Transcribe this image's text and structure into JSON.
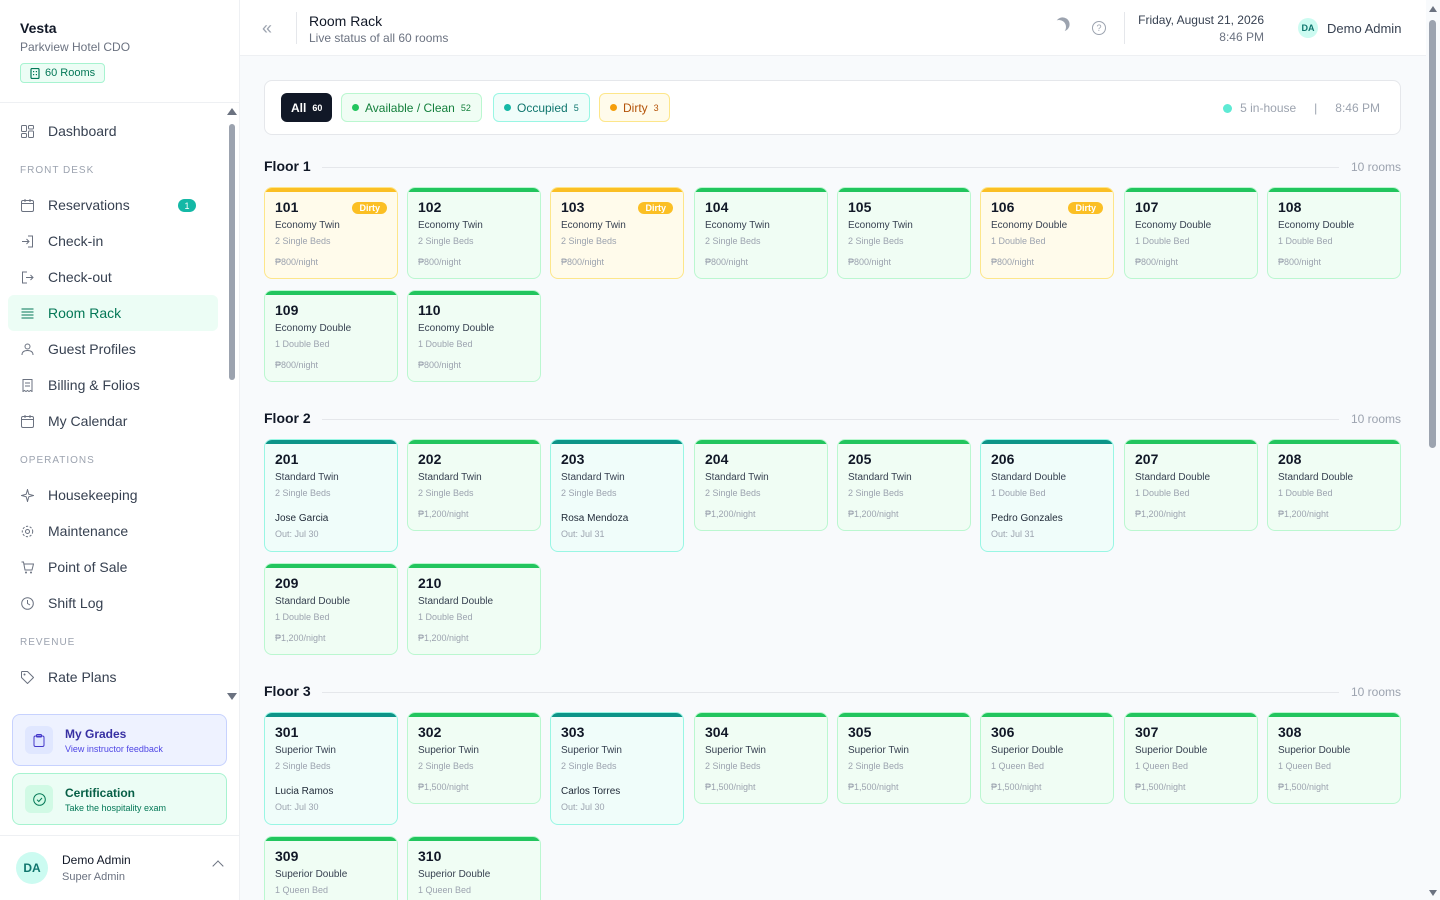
{
  "brand": {
    "name": "Vesta",
    "property": "Parkview Hotel CDO",
    "rooms_chip": "60 Rooms"
  },
  "nav": {
    "dashboard": "Dashboard",
    "front_desk_label": "FRONT DESK",
    "reservations": "Reservations",
    "reservations_badge": "1",
    "checkin": "Check-in",
    "checkout": "Check-out",
    "room_rack": "Room Rack",
    "guest_profiles": "Guest Profiles",
    "billing": "Billing & Folios",
    "calendar": "My Calendar",
    "operations_label": "OPERATIONS",
    "housekeeping": "Housekeeping",
    "maintenance": "Maintenance",
    "pos": "Point of Sale",
    "shift_log": "Shift Log",
    "revenue_label": "REVENUE",
    "rate_plans": "Rate Plans"
  },
  "promos": {
    "grades_title": "My Grades",
    "grades_sub": "View instructor feedback",
    "cert_title": "Certification",
    "cert_sub": "Take the hospitality exam"
  },
  "user": {
    "initials": "DA",
    "name": "Demo Admin",
    "role": "Super Admin"
  },
  "header": {
    "title": "Room Rack",
    "subtitle": "Live status of all 60 rooms",
    "date": "Friday, August 21, 2026",
    "time": "8:46 PM",
    "user_initials": "DA",
    "user_name": "Demo Admin"
  },
  "filters": {
    "all_label": "All",
    "all_count": "60",
    "available_label": "Available / Clean",
    "available_count": "52",
    "occupied_label": "Occupied",
    "occupied_count": "5",
    "dirty_label": "Dirty",
    "dirty_count": "3",
    "inhouse": "5 in-house",
    "separator": "|",
    "time": "8:46 PM"
  },
  "floors": [
    {
      "label": "Floor 1",
      "count": "10 rooms",
      "rooms": [
        {
          "num": "101",
          "type": "Economy Twin",
          "beds": "2 Single Beds",
          "rate": "₱800/night",
          "status": "dirty",
          "tag": "Dirty"
        },
        {
          "num": "102",
          "type": "Economy Twin",
          "beds": "2 Single Beds",
          "rate": "₱800/night",
          "status": "available"
        },
        {
          "num": "103",
          "type": "Economy Twin",
          "beds": "2 Single Beds",
          "rate": "₱800/night",
          "status": "dirty",
          "tag": "Dirty"
        },
        {
          "num": "104",
          "type": "Economy Twin",
          "beds": "2 Single Beds",
          "rate": "₱800/night",
          "status": "available"
        },
        {
          "num": "105",
          "type": "Economy Twin",
          "beds": "2 Single Beds",
          "rate": "₱800/night",
          "status": "available"
        },
        {
          "num": "106",
          "type": "Economy Double",
          "beds": "1 Double Bed",
          "rate": "₱800/night",
          "status": "dirty",
          "tag": "Dirty"
        },
        {
          "num": "107",
          "type": "Economy Double",
          "beds": "1 Double Bed",
          "rate": "₱800/night",
          "status": "available"
        },
        {
          "num": "108",
          "type": "Economy Double",
          "beds": "1 Double Bed",
          "rate": "₱800/night",
          "status": "available"
        },
        {
          "num": "109",
          "type": "Economy Double",
          "beds": "1 Double Bed",
          "rate": "₱800/night",
          "status": "available"
        },
        {
          "num": "110",
          "type": "Economy Double",
          "beds": "1 Double Bed",
          "rate": "₱800/night",
          "status": "available"
        }
      ]
    },
    {
      "label": "Floor 2",
      "count": "10 rooms",
      "rooms": [
        {
          "num": "201",
          "type": "Standard Twin",
          "beds": "2 Single Beds",
          "status": "occupied",
          "guest": "Jose Garcia",
          "out": "Out: Jul 30"
        },
        {
          "num": "202",
          "type": "Standard Twin",
          "beds": "2 Single Beds",
          "rate": "₱1,200/night",
          "status": "available"
        },
        {
          "num": "203",
          "type": "Standard Twin",
          "beds": "2 Single Beds",
          "status": "occupied",
          "guest": "Rosa Mendoza",
          "out": "Out: Jul 31"
        },
        {
          "num": "204",
          "type": "Standard Twin",
          "beds": "2 Single Beds",
          "rate": "₱1,200/night",
          "status": "available"
        },
        {
          "num": "205",
          "type": "Standard Twin",
          "beds": "2 Single Beds",
          "rate": "₱1,200/night",
          "status": "available"
        },
        {
          "num": "206",
          "type": "Standard Double",
          "beds": "1 Double Bed",
          "status": "occupied",
          "guest": "Pedro Gonzales",
          "out": "Out: Jul 31"
        },
        {
          "num": "207",
          "type": "Standard Double",
          "beds": "1 Double Bed",
          "rate": "₱1,200/night",
          "status": "available"
        },
        {
          "num": "208",
          "type": "Standard Double",
          "beds": "1 Double Bed",
          "rate": "₱1,200/night",
          "status": "available"
        },
        {
          "num": "209",
          "type": "Standard Double",
          "beds": "1 Double Bed",
          "rate": "₱1,200/night",
          "status": "available"
        },
        {
          "num": "210",
          "type": "Standard Double",
          "beds": "1 Double Bed",
          "rate": "₱1,200/night",
          "status": "available"
        }
      ]
    },
    {
      "label": "Floor 3",
      "count": "10 rooms",
      "rooms": [
        {
          "num": "301",
          "type": "Superior Twin",
          "beds": "2 Single Beds",
          "status": "occupied",
          "guest": "Lucia Ramos",
          "out": "Out: Jul 30"
        },
        {
          "num": "302",
          "type": "Superior Twin",
          "beds": "2 Single Beds",
          "rate": "₱1,500/night",
          "status": "available"
        },
        {
          "num": "303",
          "type": "Superior Twin",
          "beds": "2 Single Beds",
          "status": "occupied",
          "guest": "Carlos Torres",
          "out": "Out: Jul 30"
        },
        {
          "num": "304",
          "type": "Superior Twin",
          "beds": "2 Single Beds",
          "rate": "₱1,500/night",
          "status": "available"
        },
        {
          "num": "305",
          "type": "Superior Twin",
          "beds": "2 Single Beds",
          "rate": "₱1,500/night",
          "status": "available"
        },
        {
          "num": "306",
          "type": "Superior Double",
          "beds": "1 Queen Bed",
          "rate": "₱1,500/night",
          "status": "available"
        },
        {
          "num": "307",
          "type": "Superior Double",
          "beds": "1 Queen Bed",
          "rate": "₱1,500/night",
          "status": "available"
        },
        {
          "num": "308",
          "type": "Superior Double",
          "beds": "1 Queen Bed",
          "rate": "₱1,500/night",
          "status": "available"
        },
        {
          "num": "309",
          "type": "Superior Double",
          "beds": "1 Queen Bed",
          "status": "available"
        },
        {
          "num": "310",
          "type": "Superior Double",
          "beds": "1 Queen Bed",
          "status": "available"
        }
      ]
    }
  ]
}
